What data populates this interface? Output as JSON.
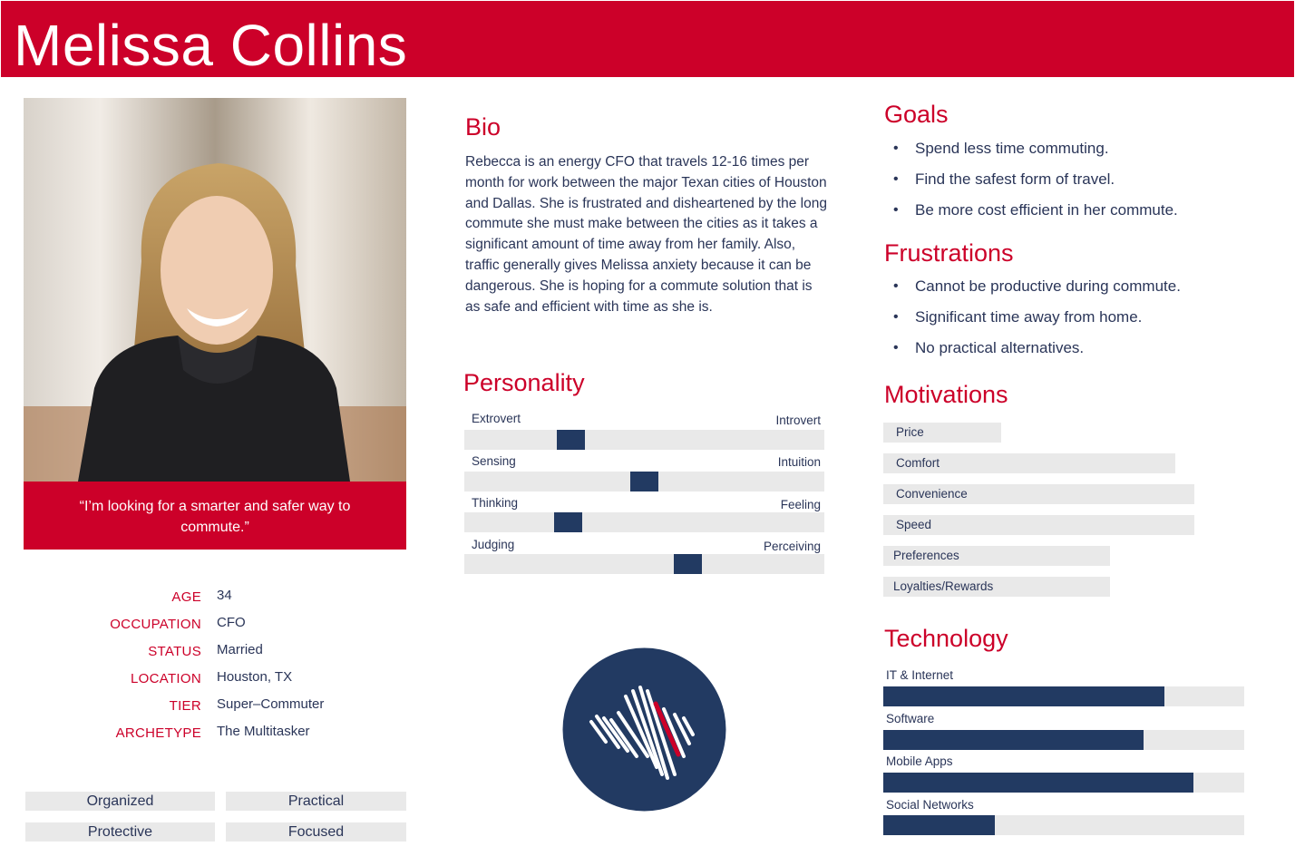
{
  "header": {
    "name": "Melissa Collins"
  },
  "quote": "“I’m looking for a smarter and safer way to commute.”",
  "info": [
    {
      "label": "AGE",
      "value": "34"
    },
    {
      "label": "OCCUPATION",
      "value": "CFO"
    },
    {
      "label": "STATUS",
      "value": "Married"
    },
    {
      "label": "LOCATION",
      "value": "Houston, TX"
    },
    {
      "label": "TIER",
      "value": "Super–Commuter"
    },
    {
      "label": "ARCHETYPE",
      "value": "The Multitasker"
    }
  ],
  "traits": [
    "Organized",
    "Practical",
    "Protective",
    "Focused"
  ],
  "bio": {
    "heading": "Bio",
    "text": "Rebecca is an energy CFO that travels 12-16 times per month for work between the major Texan cities of Houston and Dallas. She is frustrated and disheartened by the long commute she must make between the cities as it takes a significant amount of time away from her family. Also, traffic generally gives Melissa anxiety because it can be dangerous. She is hoping for a commute solution that is as safe and efficient with time as she is."
  },
  "personality": {
    "heading": "Personality",
    "scales": [
      {
        "left": "Extrovert",
        "right": "Introvert",
        "position": 0.28
      },
      {
        "left": "Sensing",
        "right": "Intuition",
        "position": 0.5
      },
      {
        "left": "Thinking",
        "right": "Feeling",
        "position": 0.27
      },
      {
        "left": "Judging",
        "right": "Perceiving",
        "position": 0.63
      }
    ]
  },
  "goals": {
    "heading": "Goals",
    "items": [
      "Spend less time commuting.",
      "Find the safest form of travel.",
      "Be more cost efficient in her commute."
    ]
  },
  "frustrations": {
    "heading": "Frustrations",
    "items": [
      "Cannot be productive during commute.",
      "Significant time away from home.",
      "No practical alternatives."
    ]
  },
  "motivations": {
    "heading": "Motivations",
    "items": [
      {
        "label": "Price",
        "level": 0.38
      },
      {
        "label": "Comfort",
        "level": 0.94
      },
      {
        "label": "Convenience",
        "level": 1.0
      },
      {
        "label": "Speed",
        "level": 1.0
      },
      {
        "label": "Preferences",
        "level": 0.73
      },
      {
        "label": "Loyalties/Rewards",
        "level": 0.73
      }
    ]
  },
  "technology": {
    "heading": "Technology",
    "items": [
      {
        "label": "IT & Internet",
        "level": 0.78
      },
      {
        "label": "Software",
        "level": 0.72
      },
      {
        "label": "Mobile Apps",
        "level": 0.86
      },
      {
        "label": "Social Networks",
        "level": 0.31
      }
    ]
  },
  "colors": {
    "brand_red": "#cc0029",
    "navy": "#223a62",
    "bar_gray": "#e9e9e9",
    "text": "#2a3558"
  }
}
